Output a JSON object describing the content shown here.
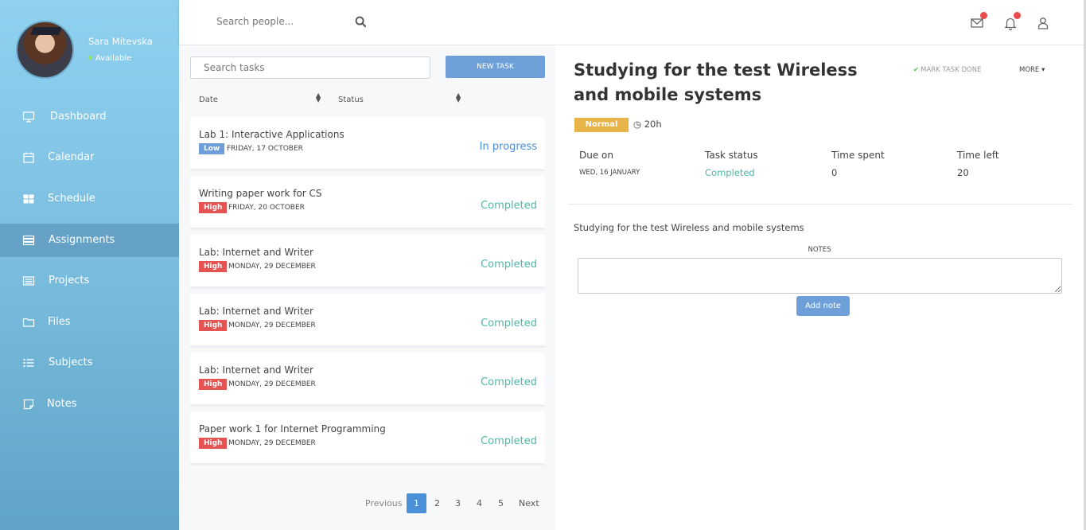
{
  "profile": {
    "name": "Sara Mitevska",
    "status": "Available"
  },
  "sidebar": {
    "items": [
      {
        "label": "Dashboard",
        "icon": "monitor-icon"
      },
      {
        "label": "Calendar",
        "icon": "calendar-icon"
      },
      {
        "label": "Schedule",
        "icon": "grid-icon"
      },
      {
        "label": "Assignments",
        "icon": "stack-icon",
        "active": true
      },
      {
        "label": "Projects",
        "icon": "list-box-icon"
      },
      {
        "label": "Files",
        "icon": "folder-icon"
      },
      {
        "label": "Subjects",
        "icon": "bullet-list-icon"
      },
      {
        "label": "Notes",
        "icon": "note-icon"
      }
    ]
  },
  "topbar": {
    "search_placeholder": "Search people..."
  },
  "tasks_panel": {
    "search_placeholder": "Search tasks",
    "new_task_label": "NEW TASK",
    "columns": {
      "date": "Date",
      "status": "Status"
    },
    "tasks": [
      {
        "title": "Lab 1: Interactive Applications",
        "priority": "Low",
        "date": "FRIDAY, 17 OCTOBER",
        "status": "In progress"
      },
      {
        "title": "Writing paper work for CS",
        "priority": "High",
        "date": "FRIDAY, 20 OCTOBER",
        "status": "Completed"
      },
      {
        "title": "Lab: Internet and Writer",
        "priority": "High",
        "date": "MONDAY, 29 DECEMBER",
        "status": "Completed"
      },
      {
        "title": "Lab: Internet and Writer",
        "priority": "High",
        "date": "MONDAY, 29 DECEMBER",
        "status": "Completed"
      },
      {
        "title": "Lab: Internet and Writer",
        "priority": "High",
        "date": "MONDAY, 29 DECEMBER",
        "status": "Completed"
      },
      {
        "title": "Paper work 1 for Internet Programming",
        "priority": "High",
        "date": "MONDAY, 29 DECEMBER",
        "status": "Completed"
      }
    ],
    "pagination": {
      "previous": "Previous",
      "pages": [
        "1",
        "2",
        "3",
        "4",
        "5"
      ],
      "current": "1",
      "next": "Next"
    }
  },
  "detail": {
    "title": "Studying for the test Wireless and mobile systems",
    "mark_done_label": "MARK TASK DONE",
    "more_label": "MORE",
    "priority": "Normal",
    "estimate": "20h",
    "info": {
      "due_label": "Due on",
      "due_value": "WED, 16 JANUARY",
      "status_label": "Task status",
      "status_value": "Completed",
      "spent_label": "Time spent",
      "spent_value": "0",
      "left_label": "Time left",
      "left_value": "20"
    },
    "description": "Studying for the test Wireless and mobile systems",
    "notes_label": "NOTES",
    "add_note_label": "Add note"
  },
  "colors": {
    "sidebar_top": "#8fd1ef",
    "sidebar_bottom": "#5fa4c7",
    "accent": "#6e9fd9",
    "completed": "#4fb8a8",
    "in_progress": "#4a90d9",
    "high": "#e55353",
    "normal": "#e8b448",
    "notification": "#e94b4b"
  }
}
